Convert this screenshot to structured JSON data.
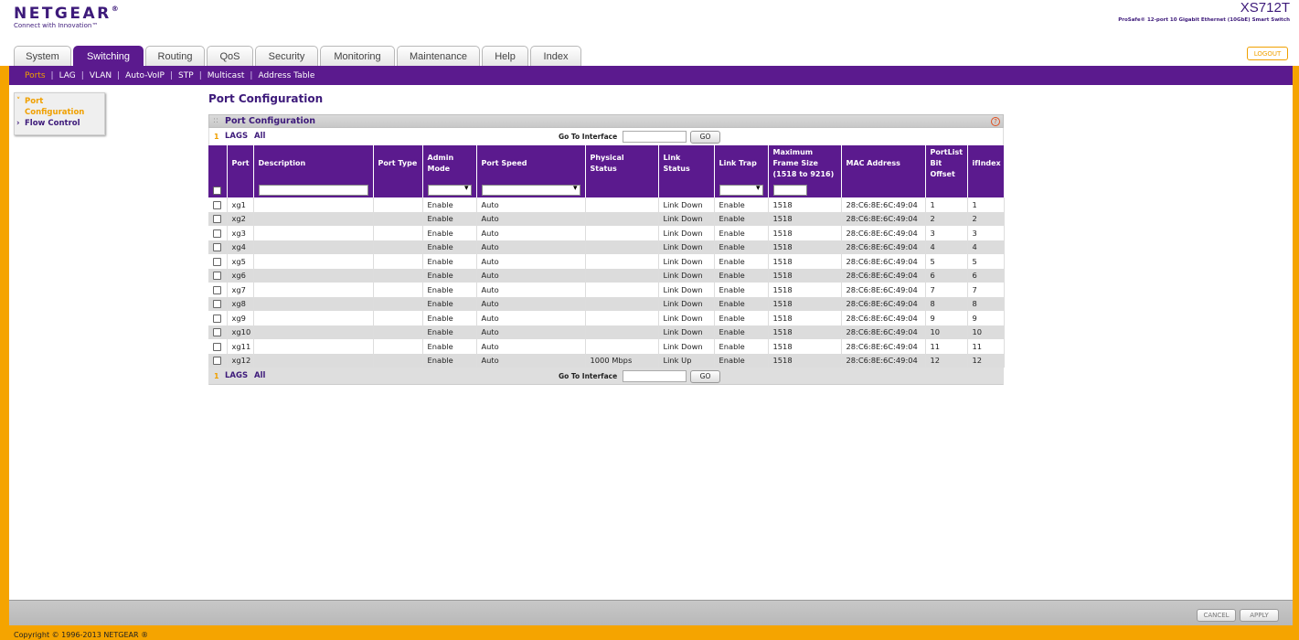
{
  "header": {
    "brand": "NETGEAR",
    "tagline": "Connect with Innovation™",
    "model": "XS712T",
    "model_desc": "ProSafe® 12-port 10 Gigabit Ethernet (10GbE) Smart Switch",
    "logout": "LOGOUT"
  },
  "tabs": [
    {
      "label": "System"
    },
    {
      "label": "Switching"
    },
    {
      "label": "Routing"
    },
    {
      "label": "QoS"
    },
    {
      "label": "Security"
    },
    {
      "label": "Monitoring"
    },
    {
      "label": "Maintenance"
    },
    {
      "label": "Help"
    },
    {
      "label": "Index"
    }
  ],
  "active_tab": "Switching",
  "subnav": [
    {
      "label": "Ports"
    },
    {
      "label": "LAG"
    },
    {
      "label": "VLAN"
    },
    {
      "label": "Auto-VoIP"
    },
    {
      "label": "STP"
    },
    {
      "label": "Multicast"
    },
    {
      "label": "Address Table"
    }
  ],
  "leftmenu": {
    "item1_line1": "Port",
    "item1_line2": "Configuration",
    "item2": "Flow Control"
  },
  "page_title": "Port Configuration",
  "panel": {
    "title": "Port Configuration",
    "help": "?",
    "nav_one": "1",
    "nav_lags": "LAGS",
    "nav_all": "All",
    "goto_label": "Go To Interface",
    "go_button": "GO"
  },
  "table": {
    "headers": {
      "port": "Port",
      "description": "Description",
      "port_type": "Port Type",
      "admin_mode": "Admin Mode",
      "port_speed": "Port Speed",
      "physical_status": "Physical Status",
      "link_status": "Link Status",
      "link_trap": "Link Trap",
      "max_frame": "Maximum Frame Size (1518 to 9216)",
      "mac": "MAC Address",
      "portlist": "PortList Bit Offset",
      "ifindex": "ifIndex"
    },
    "rows": [
      {
        "port": "xg1",
        "description": "",
        "port_type": "",
        "admin_mode": "Enable",
        "port_speed": "Auto",
        "physical_status": "",
        "link_status": "Link Down",
        "link_trap": "Enable",
        "max_frame": "1518",
        "mac": "28:C6:8E:6C:49:04",
        "portlist": "1",
        "ifindex": "1"
      },
      {
        "port": "xg2",
        "description": "",
        "port_type": "",
        "admin_mode": "Enable",
        "port_speed": "Auto",
        "physical_status": "",
        "link_status": "Link Down",
        "link_trap": "Enable",
        "max_frame": "1518",
        "mac": "28:C6:8E:6C:49:04",
        "portlist": "2",
        "ifindex": "2"
      },
      {
        "port": "xg3",
        "description": "",
        "port_type": "",
        "admin_mode": "Enable",
        "port_speed": "Auto",
        "physical_status": "",
        "link_status": "Link Down",
        "link_trap": "Enable",
        "max_frame": "1518",
        "mac": "28:C6:8E:6C:49:04",
        "portlist": "3",
        "ifindex": "3"
      },
      {
        "port": "xg4",
        "description": "",
        "port_type": "",
        "admin_mode": "Enable",
        "port_speed": "Auto",
        "physical_status": "",
        "link_status": "Link Down",
        "link_trap": "Enable",
        "max_frame": "1518",
        "mac": "28:C6:8E:6C:49:04",
        "portlist": "4",
        "ifindex": "4"
      },
      {
        "port": "xg5",
        "description": "",
        "port_type": "",
        "admin_mode": "Enable",
        "port_speed": "Auto",
        "physical_status": "",
        "link_status": "Link Down",
        "link_trap": "Enable",
        "max_frame": "1518",
        "mac": "28:C6:8E:6C:49:04",
        "portlist": "5",
        "ifindex": "5"
      },
      {
        "port": "xg6",
        "description": "",
        "port_type": "",
        "admin_mode": "Enable",
        "port_speed": "Auto",
        "physical_status": "",
        "link_status": "Link Down",
        "link_trap": "Enable",
        "max_frame": "1518",
        "mac": "28:C6:8E:6C:49:04",
        "portlist": "6",
        "ifindex": "6"
      },
      {
        "port": "xg7",
        "description": "",
        "port_type": "",
        "admin_mode": "Enable",
        "port_speed": "Auto",
        "physical_status": "",
        "link_status": "Link Down",
        "link_trap": "Enable",
        "max_frame": "1518",
        "mac": "28:C6:8E:6C:49:04",
        "portlist": "7",
        "ifindex": "7"
      },
      {
        "port": "xg8",
        "description": "",
        "port_type": "",
        "admin_mode": "Enable",
        "port_speed": "Auto",
        "physical_status": "",
        "link_status": "Link Down",
        "link_trap": "Enable",
        "max_frame": "1518",
        "mac": "28:C6:8E:6C:49:04",
        "portlist": "8",
        "ifindex": "8"
      },
      {
        "port": "xg9",
        "description": "",
        "port_type": "",
        "admin_mode": "Enable",
        "port_speed": "Auto",
        "physical_status": "",
        "link_status": "Link Down",
        "link_trap": "Enable",
        "max_frame": "1518",
        "mac": "28:C6:8E:6C:49:04",
        "portlist": "9",
        "ifindex": "9"
      },
      {
        "port": "xg10",
        "description": "",
        "port_type": "",
        "admin_mode": "Enable",
        "port_speed": "Auto",
        "physical_status": "",
        "link_status": "Link Down",
        "link_trap": "Enable",
        "max_frame": "1518",
        "mac": "28:C6:8E:6C:49:04",
        "portlist": "10",
        "ifindex": "10"
      },
      {
        "port": "xg11",
        "description": "",
        "port_type": "",
        "admin_mode": "Enable",
        "port_speed": "Auto",
        "physical_status": "",
        "link_status": "Link Down",
        "link_trap": "Enable",
        "max_frame": "1518",
        "mac": "28:C6:8E:6C:49:04",
        "portlist": "11",
        "ifindex": "11"
      },
      {
        "port": "xg12",
        "description": "",
        "port_type": "",
        "admin_mode": "Enable",
        "port_speed": "Auto",
        "physical_status": "1000 Mbps",
        "link_status": "Link Up",
        "link_trap": "Enable",
        "max_frame": "1518",
        "mac": "28:C6:8E:6C:49:04",
        "portlist": "12",
        "ifindex": "12"
      }
    ]
  },
  "buttons": {
    "cancel": "CANCEL",
    "apply": "APPLY"
  },
  "footer": {
    "copyright": "Copyright © 1996-2013 NETGEAR ®"
  },
  "colors": {
    "brand_purple": "#5b1a8e",
    "accent_orange": "#f5a400"
  }
}
